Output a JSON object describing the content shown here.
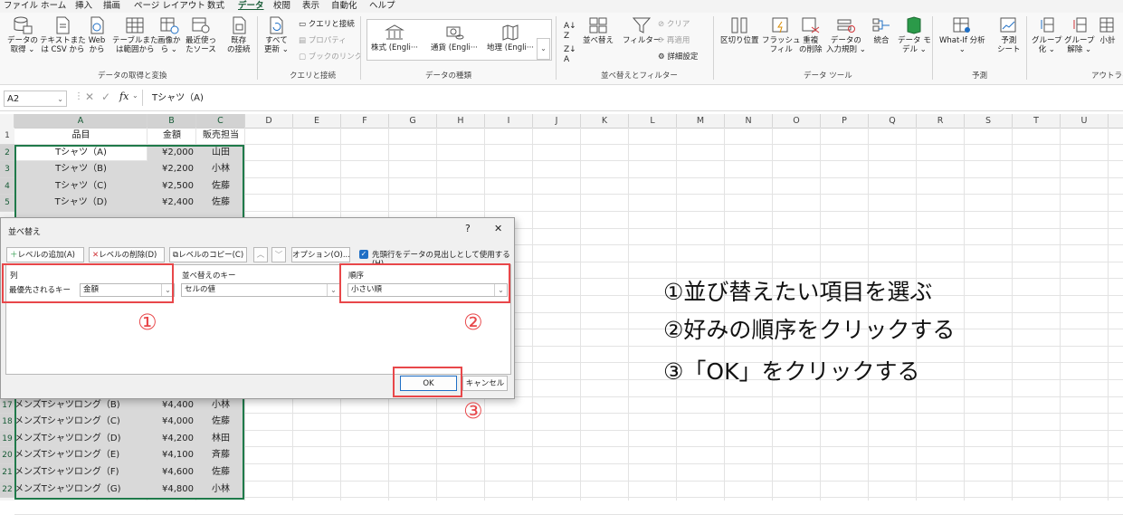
{
  "menu": [
    "ファイル",
    "ホーム",
    "挿入",
    "描画",
    "ページ レイアウト",
    "数式",
    "データ",
    "校閲",
    "表示",
    "自動化",
    "ヘルプ"
  ],
  "menu_active_index": 6,
  "ribbon": {
    "get_data": {
      "btn1": "データの",
      "btn1b": "取得 ⌄",
      "btn2": "テキストまた",
      "btn2b": "は CSV から",
      "btn3": "Web",
      "btn3b": "から",
      "btn4": "テーブルまた",
      "btn4b": "は範囲から",
      "btn5": "画像か",
      "btn5b": "ら ⌄",
      "btn6": "最近使っ",
      "btn6b": "たソース",
      "btn7": "既存",
      "btn7b": "の接続",
      "label": "データの取得と変換"
    },
    "queries": {
      "refresh": "すべて",
      "refresh_b": "更新 ⌄",
      "q1": "クエリと接続",
      "q2": "プロパティ",
      "q3": "ブックのリンク",
      "label": "クエリと接続"
    },
    "datatypes": {
      "t1": "株式 (Engli···",
      "t2": "通貨 (Engli···",
      "t3": "地理 (Engli···",
      "label": "データの種類"
    },
    "sort": {
      "sort_btn": "並べ替え",
      "filter": "フィルター",
      "clear": "クリア",
      "reapply": "再適用",
      "advanced": "詳細設定",
      "label": "並べ替えとフィルター"
    },
    "tools": {
      "t1": "区切り位置",
      "t2": "フラッシュ",
      "t2b": "フィル",
      "t3": "重複",
      "t3b": "の削除",
      "t4": "データの",
      "t4b": "入力規則 ⌄",
      "t5": "統合",
      "t6": "データ モ",
      "t6b": "デル ⌄",
      "label": "データ ツール"
    },
    "forecast": {
      "f1": "What-If 分析",
      "f1b": "⌄",
      "f2": "予測",
      "f2b": "シート",
      "label": "予測"
    },
    "outline": {
      "o1": "グループ",
      "o1b": "化 ⌄",
      "o2": "グループ",
      "o2b": "解除 ⌄",
      "o3": "小計",
      "label": "アウトライ"
    }
  },
  "namebox": "A2",
  "fx": "fx",
  "formula": "Tシャツ（A)",
  "columns": [
    "A",
    "B",
    "C",
    "D",
    "E",
    "F",
    "G",
    "H",
    "I",
    "J",
    "K",
    "L",
    "M",
    "N",
    "O",
    "P",
    "Q",
    "R",
    "S",
    "T",
    "U"
  ],
  "header_row": {
    "a": "品目",
    "b": "金額",
    "c": "販売担当"
  },
  "rows_top": [
    {
      "num": "2",
      "a": "Tシャツ（A)",
      "b": "¥2,000",
      "c": "山田"
    },
    {
      "num": "3",
      "a": "Tシャツ（B)",
      "b": "¥2,200",
      "c": "小林"
    },
    {
      "num": "4",
      "a": "Tシャツ（C)",
      "b": "¥2,500",
      "c": "佐藤"
    },
    {
      "num": "5",
      "a": "Tシャツ（D)",
      "b": "¥2,400",
      "c": "佐藤"
    }
  ],
  "rows_bottom": [
    {
      "num": "17",
      "a": "メンズTシャツロング（B)",
      "b": "¥4,400",
      "c": "小林"
    },
    {
      "num": "18",
      "a": "メンズTシャツロング（C)",
      "b": "¥4,000",
      "c": "佐藤"
    },
    {
      "num": "19",
      "a": "メンズTシャツロング（D)",
      "b": "¥4,200",
      "c": "林田"
    },
    {
      "num": "20",
      "a": "メンズTシャツロング（E)",
      "b": "¥4,100",
      "c": "斉藤"
    },
    {
      "num": "21",
      "a": "メンズTシャツロング（F)",
      "b": "¥4,600",
      "c": "佐藤"
    },
    {
      "num": "22",
      "a": "メンズTシャツロング（G)",
      "b": "¥4,800",
      "c": "小林"
    }
  ],
  "dialog": {
    "title": "並べ替え",
    "help": "?",
    "close": "✕",
    "add_level": "レベルの追加(A)",
    "delete_level": "レベルの削除(D)",
    "copy_level": "レベルのコピー(C)",
    "options": "オプション(O)...",
    "header_checkbox": "先頭行をデータの見出しとして使用する(H)",
    "col_header": "列",
    "key_header": "並べ替えのキー",
    "order_header": "順序",
    "priority_label": "最優先されるキー",
    "column_value": "金額",
    "key_value": "セルの値",
    "order_value": "小さい順",
    "ok": "OK",
    "cancel": "キャンセル"
  },
  "markers": {
    "m1": "①",
    "m2": "②",
    "m3": "③"
  },
  "annotations": [
    "①並び替えたい項目を選ぶ",
    "②好みの順序をクリックする",
    "③「OK」をクリックする"
  ],
  "colors": {
    "accent_green": "#185c37",
    "highlight_red": "#e8474a",
    "selection_gray": "#d9d9d9"
  }
}
